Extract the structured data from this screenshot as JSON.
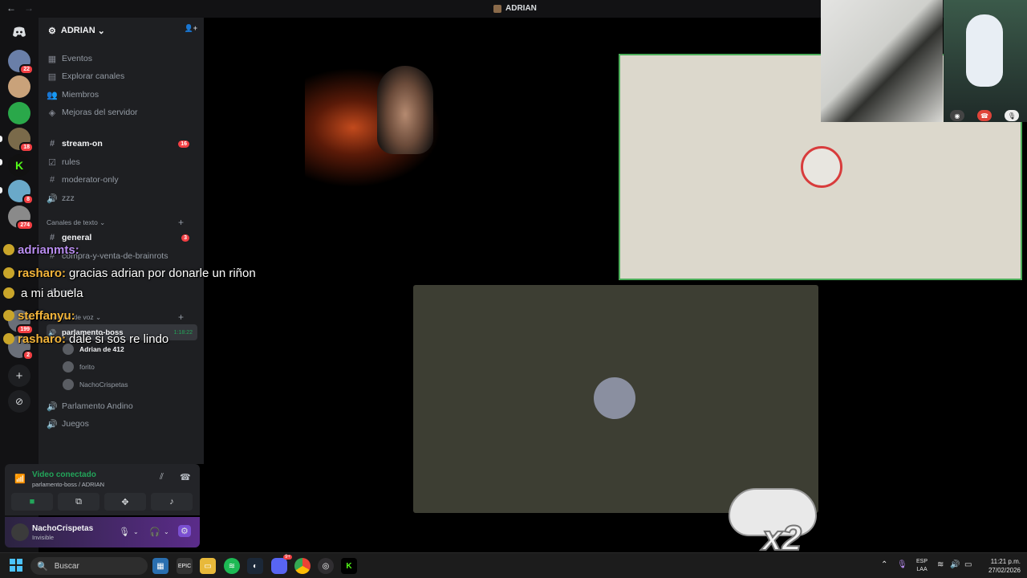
{
  "titlebar": {
    "title": "ADRIAN",
    "back": "←",
    "forward": "→"
  },
  "rail": {
    "servers": [
      {
        "badge": "22",
        "color": "#6a7fa8"
      },
      {
        "badge": "",
        "color": "#c9a27a"
      },
      {
        "badge": "",
        "color": "#2aa84a"
      },
      {
        "badge": "18",
        "color": "#7a6a4a"
      },
      {
        "badge": "",
        "color": "#111111",
        "glyph": "K",
        "glyph_color": "#53fc18"
      },
      {
        "badge": "8",
        "color": "#6aa9c9"
      },
      {
        "badge": "274",
        "color": "#8a8a8a"
      }
    ],
    "lower_badges": [
      "199",
      "2"
    ]
  },
  "server": {
    "name": "ADRIAN",
    "chevron": "⌄",
    "invite_icon": "👤+"
  },
  "nav_items": [
    {
      "label": "Eventos",
      "icon": "calendar-icon",
      "glyph": "▦"
    },
    {
      "label": "Explorar canales",
      "icon": "browse-icon",
      "glyph": "▤"
    },
    {
      "label": "Miembros",
      "icon": "members-icon",
      "glyph": "👥"
    },
    {
      "label": "Mejoras del servidor",
      "icon": "boost-icon",
      "glyph": "◈"
    }
  ],
  "channels_top": [
    {
      "label": "stream-on",
      "glyph": "#",
      "bold": true,
      "count": "16"
    },
    {
      "label": "rules",
      "glyph": "☑",
      "bold": false,
      "count": ""
    },
    {
      "label": "moderator-only",
      "glyph": "#",
      "bold": false,
      "count": ""
    },
    {
      "label": "zzz",
      "glyph": "🔊",
      "bold": false,
      "count": ""
    }
  ],
  "text_category": {
    "label": "Canales de texto",
    "chevron": "⌄"
  },
  "channels_text": [
    {
      "label": "general",
      "glyph": "#",
      "bold": true,
      "count": "3"
    },
    {
      "label": "compra-y-venta-de-brainrots",
      "glyph": "#",
      "bold": false,
      "count": ""
    },
    {
      "label": "arte",
      "glyph": "#",
      "bold": false,
      "count": ""
    }
  ],
  "voice_category": {
    "label": "Canales de voz",
    "chevron": "⌄"
  },
  "voice_channel": {
    "label": "parlamento-boss",
    "glyph": "🔊",
    "time": "1:18:22"
  },
  "voice_users": [
    {
      "name": "Adrian de 412",
      "bold": true
    },
    {
      "name": "forito",
      "bold": false
    },
    {
      "name": "NachoCrispetas",
      "bold": false
    }
  ],
  "channels_bottom": [
    {
      "label": "Parlamento Andino",
      "glyph": "🔊"
    },
    {
      "label": "Juegos",
      "glyph": "🔊"
    }
  ],
  "voice_panel": {
    "status": "Video conectado",
    "subtitle": "parlamento-boss / ADRIAN",
    "buttons": [
      "camera",
      "screen-share",
      "activities",
      "soundboard"
    ],
    "button_glyphs": [
      "■",
      "⧉",
      "✥",
      "♪"
    ]
  },
  "user_panel": {
    "name": "NachoCrispetas",
    "status": "Invisible"
  },
  "chat_overlay": [
    {
      "user": "adrianmts:",
      "msg": "",
      "gold": false
    },
    {
      "user": "rasharo:",
      "msg": "gracias adrian por donarle un riñon",
      "gold": true
    },
    {
      "user": "",
      "msg": "a mi abuela",
      "gold": false
    },
    {
      "user": "steffanyu:",
      "msg": "",
      "gold": true
    },
    {
      "user": "rasharo:",
      "msg": "dale si sos re lindo",
      "gold": true
    }
  ],
  "sticker": {
    "text": "x2"
  },
  "taskbar": {
    "search_placeholder": "Buscar",
    "lang_top": "ESP",
    "lang_bottom": "LAA",
    "time": "11:21 p.m.",
    "date": "27/02/2026",
    "discord_badge": "9+"
  },
  "colors": {
    "accent": "#5865f2",
    "online": "#23a55a",
    "alert": "#f23f43"
  }
}
